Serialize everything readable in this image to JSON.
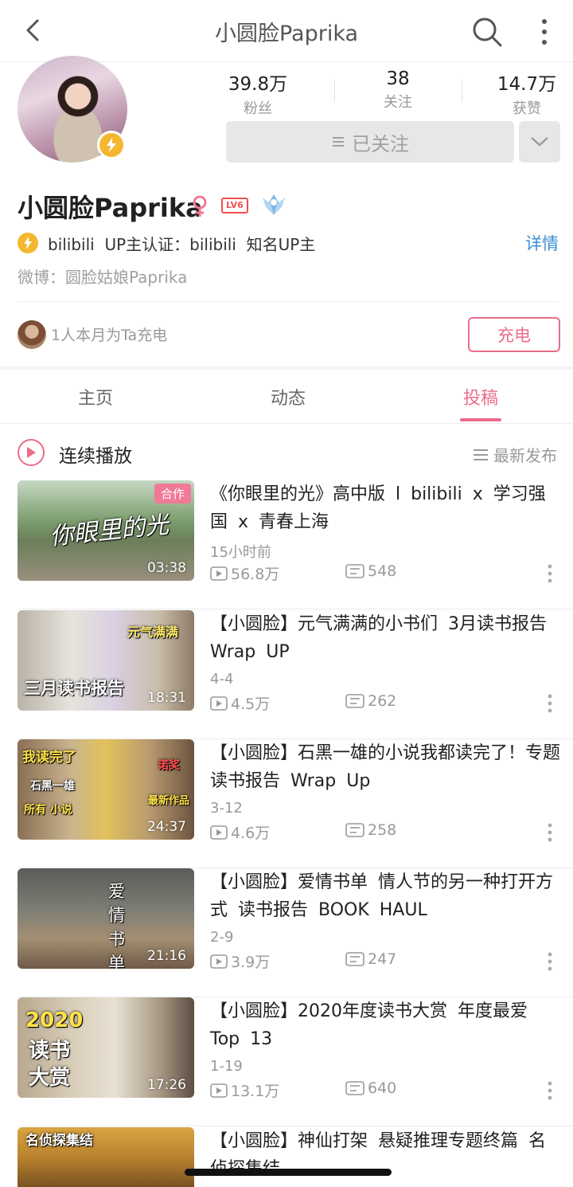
{
  "header": {
    "title": "小圆脸Paprika"
  },
  "stats": [
    {
      "value": "39.8万",
      "label": "粉丝"
    },
    {
      "value": "38",
      "label": "关注"
    },
    {
      "value": "14.7万",
      "label": "获赞"
    }
  ],
  "follow": {
    "label": "已关注"
  },
  "profile": {
    "name": "小圆脸Paprika",
    "level_badge": "LV6",
    "verify": "bilibili  UP主认证：bilibili  知名UP主",
    "detail": "详情",
    "weibo": "微博：圆脸姑娘Paprika"
  },
  "charge": {
    "text": "1人本月为Ta充电",
    "button": "充电"
  },
  "tabs": [
    {
      "label": "主页"
    },
    {
      "label": "动态"
    },
    {
      "label": "投稿",
      "active": true
    }
  ],
  "list_controls": {
    "autoplay": "连续播放",
    "sort": "最新发布"
  },
  "colors": {
    "accent": "#ea6d8a",
    "link": "#3d8fd5",
    "verify": "#f5b731"
  },
  "videos": [
    {
      "title": "《你眼里的光》高中版 l bilibili x 学习强国 x 青春上海",
      "tag": "合作",
      "overlay": "你眼里的光",
      "duration": "03:38",
      "date": "15小时前",
      "plays": "56.8万",
      "danmaku": "548"
    },
    {
      "title": "【小圆脸】元气满满的小书们 3月读书报告 Wrap UP",
      "overlay": "三月读书报告",
      "overlay2": "元气满满",
      "duration": "18:31",
      "date": "4-4",
      "plays": "4.5万",
      "danmaku": "262"
    },
    {
      "title": "【小圆脸】石黑一雄的小说我都读完了！专题读书报告 Wrap Up",
      "overlay": "我读完了",
      "overlay2": "石黑一雄",
      "overlay3": "所有 小说",
      "overlay4": "诺奖",
      "overlay5": "最新作品",
      "duration": "24:37",
      "date": "3-12",
      "plays": "4.6万",
      "danmaku": "258"
    },
    {
      "title": "【小圆脸】爱情书单 情人节的另一种打开方式 读书报告 BOOK HAUL",
      "overlay": "爱情书单",
      "duration": "21:16",
      "date": "2-9",
      "plays": "3.9万",
      "danmaku": "247"
    },
    {
      "title": "【小圆脸】2020年度读书大赏 年度最爱 Top 13",
      "overlay": "2020",
      "overlay2": "读书大赏",
      "duration": "17:26",
      "date": "1-19",
      "plays": "13.1万",
      "danmaku": "640"
    },
    {
      "title": "【小圆脸】神仙打架 悬疑推理专题终篇 名侦探集结",
      "overlay": "名侦探集结"
    }
  ]
}
